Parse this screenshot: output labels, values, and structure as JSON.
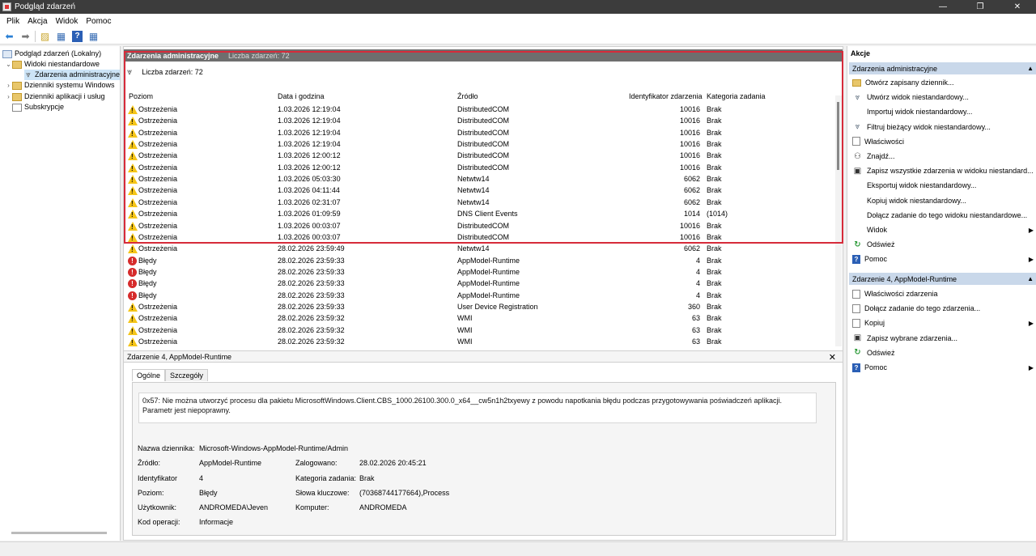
{
  "window": {
    "title": "Podgląd zdarzeń",
    "controls": [
      "—",
      "❐",
      "✕"
    ]
  },
  "menu": [
    "Plik",
    "Akcja",
    "Widok",
    "Pomoc"
  ],
  "tree": [
    {
      "label": "Podgląd zdarzeń (Lokalny)",
      "exp": "",
      "icon": "pc"
    },
    {
      "label": "Widoki niestandardowe",
      "exp": "⌄",
      "icon": "folder"
    },
    {
      "label": "Zdarzenia administracyjne",
      "exp": "",
      "icon": "filter"
    },
    {
      "label": "Dzienniki systemu Windows",
      "exp": "›",
      "icon": "folder"
    },
    {
      "label": "Dzienniki aplikacji i usług",
      "exp": "›",
      "icon": "folder"
    },
    {
      "label": "Subskrypcje",
      "exp": "",
      "icon": "log"
    }
  ],
  "center": {
    "header_title": "Zdarzenia administracyjne",
    "header_count": "Liczba zdarzeń: 72",
    "filter_text": "Liczba zdarzeń: 72",
    "columns": [
      "Poziom",
      "Data i godzina",
      "Źródło",
      "Identyfikator zdarzenia",
      "Kategoria zadania"
    ],
    "rows": [
      {
        "level": "Ostrzeżenia",
        "type": "warn",
        "date": "1.03.2026 12:19:04",
        "source": "DistributedCOM",
        "id": "10016",
        "category": "Brak"
      },
      {
        "level": "Ostrzeżenia",
        "type": "warn",
        "date": "1.03.2026 12:19:04",
        "source": "DistributedCOM",
        "id": "10016",
        "category": "Brak"
      },
      {
        "level": "Ostrzeżenia",
        "type": "warn",
        "date": "1.03.2026 12:19:04",
        "source": "DistributedCOM",
        "id": "10016",
        "category": "Brak"
      },
      {
        "level": "Ostrzeżenia",
        "type": "warn",
        "date": "1.03.2026 12:19:04",
        "source": "DistributedCOM",
        "id": "10016",
        "category": "Brak"
      },
      {
        "level": "Ostrzeżenia",
        "type": "warn",
        "date": "1.03.2026 12:00:12",
        "source": "DistributedCOM",
        "id": "10016",
        "category": "Brak"
      },
      {
        "level": "Ostrzeżenia",
        "type": "warn",
        "date": "1.03.2026 12:00:12",
        "source": "DistributedCOM",
        "id": "10016",
        "category": "Brak"
      },
      {
        "level": "Ostrzeżenia",
        "type": "warn",
        "date": "1.03.2026 05:03:30",
        "source": "Netwtw14",
        "id": "6062",
        "category": "Brak"
      },
      {
        "level": "Ostrzeżenia",
        "type": "warn",
        "date": "1.03.2026 04:11:44",
        "source": "Netwtw14",
        "id": "6062",
        "category": "Brak"
      },
      {
        "level": "Ostrzeżenia",
        "type": "warn",
        "date": "1.03.2026 02:31:07",
        "source": "Netwtw14",
        "id": "6062",
        "category": "Brak"
      },
      {
        "level": "Ostrzeżenia",
        "type": "warn",
        "date": "1.03.2026 01:09:59",
        "source": "DNS Client Events",
        "id": "1014",
        "category": "(1014)"
      },
      {
        "level": "Ostrzeżenia",
        "type": "warn",
        "date": "1.03.2026 00:03:07",
        "source": "DistributedCOM",
        "id": "10016",
        "category": "Brak"
      },
      {
        "level": "Ostrzeżenia",
        "type": "warn",
        "date": "1.03.2026 00:03:07",
        "source": "DistributedCOM",
        "id": "10016",
        "category": "Brak"
      },
      {
        "level": "Ostrzeżenia",
        "type": "warn",
        "date": "28.02.2026 23:59:49",
        "source": "Netwtw14",
        "id": "6062",
        "category": "Brak"
      },
      {
        "level": "Błędy",
        "type": "err",
        "date": "28.02.2026 23:59:33",
        "source": "AppModel-Runtime",
        "id": "4",
        "category": "Brak"
      },
      {
        "level": "Błędy",
        "type": "err",
        "date": "28.02.2026 23:59:33",
        "source": "AppModel-Runtime",
        "id": "4",
        "category": "Brak"
      },
      {
        "level": "Błędy",
        "type": "err",
        "date": "28.02.2026 23:59:33",
        "source": "AppModel-Runtime",
        "id": "4",
        "category": "Brak"
      },
      {
        "level": "Błędy",
        "type": "err",
        "date": "28.02.2026 23:59:33",
        "source": "AppModel-Runtime",
        "id": "4",
        "category": "Brak"
      },
      {
        "level": "Ostrzeżenia",
        "type": "warn",
        "date": "28.02.2026 23:59:33",
        "source": "User Device Registration",
        "id": "360",
        "category": "Brak"
      },
      {
        "level": "Ostrzeżenia",
        "type": "warn",
        "date": "28.02.2026 23:59:32",
        "source": "WMI",
        "id": "63",
        "category": "Brak"
      },
      {
        "level": "Ostrzeżenia",
        "type": "warn",
        "date": "28.02.2026 23:59:32",
        "source": "WMI",
        "id": "63",
        "category": "Brak"
      },
      {
        "level": "Ostrzeżenia",
        "type": "warn",
        "date": "28.02.2026 23:59:32",
        "source": "WMI",
        "id": "63",
        "category": "Brak"
      }
    ]
  },
  "detail": {
    "title": "Zdarzenie 4, AppModel-Runtime",
    "close": "✕",
    "tabs": [
      "Ogólne",
      "Szczegóły"
    ],
    "message": "0x57: Nie można utworzyć procesu dla pakietu MicrosoftWindows.Client.CBS_1000.26100.300.0_x64__cw5n1h2txyewy z powodu napotkania błędu podczas przygotowywania poświadczeń aplikacji. Parametr jest niepoprawny.",
    "log_name_label": "Nazwa dziennika:",
    "log_name": "Microsoft-Windows-AppModel-Runtime/Admin",
    "source_label": "Źródło:",
    "source": "AppModel-Runtime",
    "logged_label": "Zalogowano:",
    "logged": "28.02.2026 20:45:21",
    "id_label": "Identyfikator",
    "id": "4",
    "category_label": "Kategoria zadania:",
    "category": "Brak",
    "level_label": "Poziom:",
    "level": "Błędy",
    "keywords_label": "Słowa kluczowe:",
    "keywords": "(70368744177664),Process",
    "user_label": "Użytkownik:",
    "user": "ANDROMEDA\\Jeven",
    "computer_label": "Komputer:",
    "computer": "ANDROMEDA",
    "opcode_label": "Kod operacji:",
    "opcode": "Informacje"
  },
  "actions": {
    "title": "Akcje",
    "section1": "Zdarzenia administracyjne",
    "items1": [
      {
        "label": "Otwórz zapisany dziennik...",
        "icon": "folder"
      },
      {
        "label": "Utwórz widok niestandardowy...",
        "icon": "filter"
      },
      {
        "label": "Importuj widok niestandardowy...",
        "icon": "blank"
      },
      {
        "label": "Filtruj bieżący widok niestandardowy...",
        "icon": "filter"
      },
      {
        "label": "Właściwości",
        "icon": "props"
      },
      {
        "label": "Znajdź...",
        "icon": "find"
      },
      {
        "label": "Zapisz wszystkie zdarzenia w widoku niestandard...",
        "icon": "save"
      },
      {
        "label": "Eksportuj widok niestandardowy...",
        "icon": "blank"
      },
      {
        "label": "Kopiuj widok niestandardowy...",
        "icon": "blank"
      },
      {
        "label": "Dołącz zadanie do tego widoku niestandardowe...",
        "icon": "blank"
      },
      {
        "label": "Widok",
        "icon": "blank",
        "arrow": true
      },
      {
        "label": "Odśwież",
        "icon": "refresh"
      },
      {
        "label": "Pomoc",
        "icon": "help",
        "arrow": true
      }
    ],
    "section2": "Zdarzenie 4, AppModel-Runtime",
    "items2": [
      {
        "label": "Właściwości zdarzenia",
        "icon": "props"
      },
      {
        "label": "Dołącz zadanie do tego zdarzenia...",
        "icon": "props"
      },
      {
        "label": "Kopiuj",
        "icon": "props",
        "arrow": true
      },
      {
        "label": "Zapisz wybrane zdarzenia...",
        "icon": "save"
      },
      {
        "label": "Odśwież",
        "icon": "refresh"
      },
      {
        "label": "Pomoc",
        "icon": "help",
        "arrow": true
      }
    ]
  }
}
